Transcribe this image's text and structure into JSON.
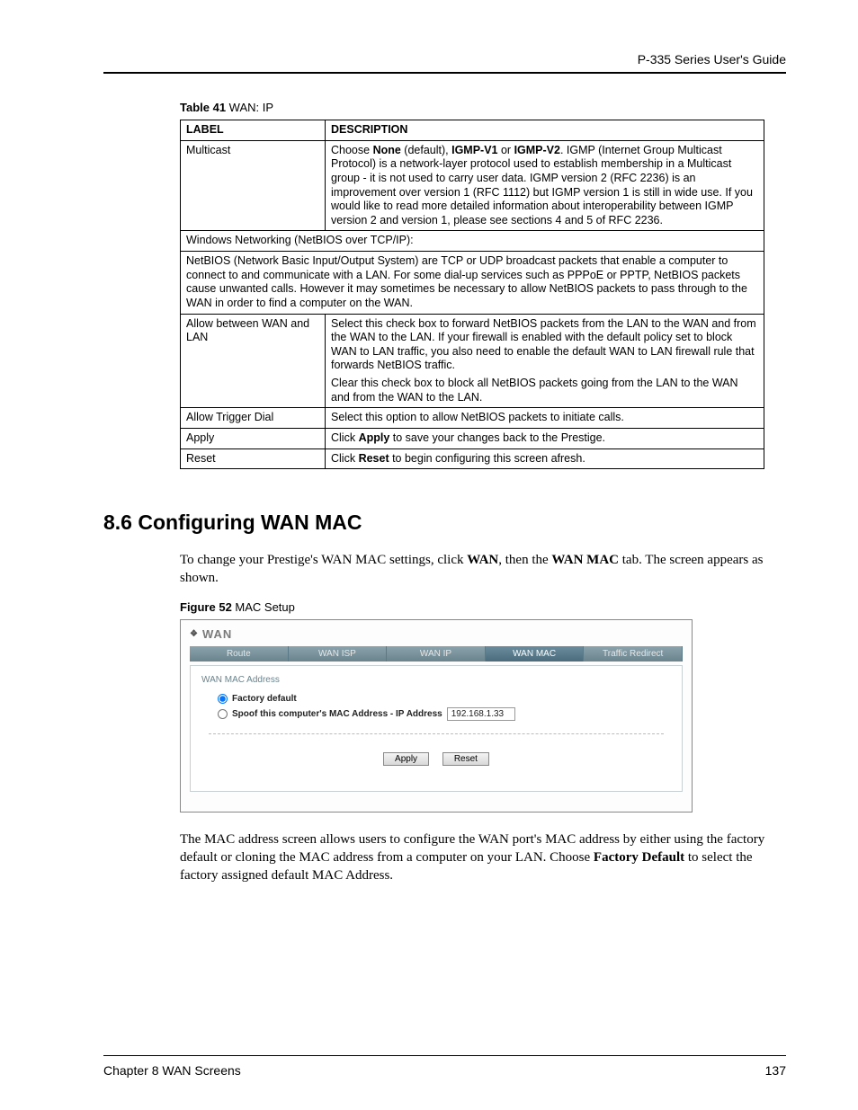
{
  "header": {
    "guide_title": "P-335 Series User's Guide"
  },
  "table_caption": {
    "label_bold": "Table 41",
    "label_rest": "   WAN: IP"
  },
  "table": {
    "head": {
      "col1": "LABEL",
      "col2": "DESCRIPTION"
    },
    "rows": {
      "multicast_label": "Multicast",
      "multicast_desc_pre": "Choose ",
      "multicast_desc_b1": "None",
      "multicast_desc_mid1": " (default), ",
      "multicast_desc_b2": "IGMP-V1",
      "multicast_desc_mid2": " or ",
      "multicast_desc_b3": "IGMP-V2",
      "multicast_desc_post": ". IGMP (Internet Group Multicast Protocol) is a network-layer protocol used to establish membership in a Multicast group - it is not used to carry user data. IGMP version 2 (RFC 2236) is an improvement over version 1 (RFC 1112) but IGMP version 1 is still in wide use. If you would like to read more detailed information about interoperability between IGMP version 2 and version 1, please see sections 4 and 5 of RFC 2236.",
      "netbios_span1": "Windows Networking (NetBIOS over TCP/IP):",
      "netbios_span2": "NetBIOS (Network Basic Input/Output System) are TCP or UDP broadcast packets that enable a computer to connect to and communicate with a LAN. For some dial-up services such as PPPoE or PPTP, NetBIOS packets cause unwanted calls. However it may sometimes be necessary to allow NetBIOS packets to pass through to the WAN in order to find a computer on the WAN.",
      "allow_label": "Allow between WAN and LAN",
      "allow_desc_p1": "Select this check box to forward NetBIOS packets from the LAN to the WAN and from the WAN to the LAN. If your firewall is enabled with the default policy set to block WAN to LAN traffic, you also need to enable the default WAN to LAN firewall rule that forwards NetBIOS traffic.",
      "allow_desc_p2": "Clear this check box to block all NetBIOS packets going from the LAN to the WAN and from the WAN to the LAN.",
      "trigger_label": "Allow Trigger Dial",
      "trigger_desc": "Select this option to allow NetBIOS packets to initiate calls.",
      "apply_label": "Apply",
      "apply_desc_pre": "Click ",
      "apply_desc_b": "Apply",
      "apply_desc_post": " to save your changes back to the Prestige.",
      "reset_label": "Reset",
      "reset_desc_pre": "Click ",
      "reset_desc_b": "Reset",
      "reset_desc_post": " to begin configuring this screen afresh."
    }
  },
  "section": {
    "heading": "8.6  Configuring WAN MAC"
  },
  "para1": {
    "pre": "To change your Prestige's WAN MAC settings, click ",
    "b1": "WAN",
    "mid": ", then the ",
    "b2": "WAN MAC",
    "post": " tab.  The screen appears as shown."
  },
  "figure_caption": {
    "bold": "Figure 52",
    "rest": "   MAC Setup"
  },
  "figure": {
    "breadcrumb_icon": "❖",
    "breadcrumb": "WAN",
    "tabs": [
      "Route",
      "WAN ISP",
      "WAN IP",
      "WAN MAC",
      "Traffic Redirect"
    ],
    "active_tab_index": 3,
    "panel_title": "WAN MAC Address",
    "opt1": "Factory default",
    "opt2": "Spoof this computer's MAC Address - IP Address",
    "ip_value": "192.168.1.33",
    "btn_apply": "Apply",
    "btn_reset": "Reset"
  },
  "para2": {
    "pre": "The MAC address screen allows users to configure the WAN port's MAC address by either using the factory default or cloning the MAC address from a computer on your LAN. Choose ",
    "b1": "Factory Default",
    "post": " to select the factory assigned default MAC Address."
  },
  "footer": {
    "left": "Chapter 8 WAN Screens",
    "right": "137"
  }
}
